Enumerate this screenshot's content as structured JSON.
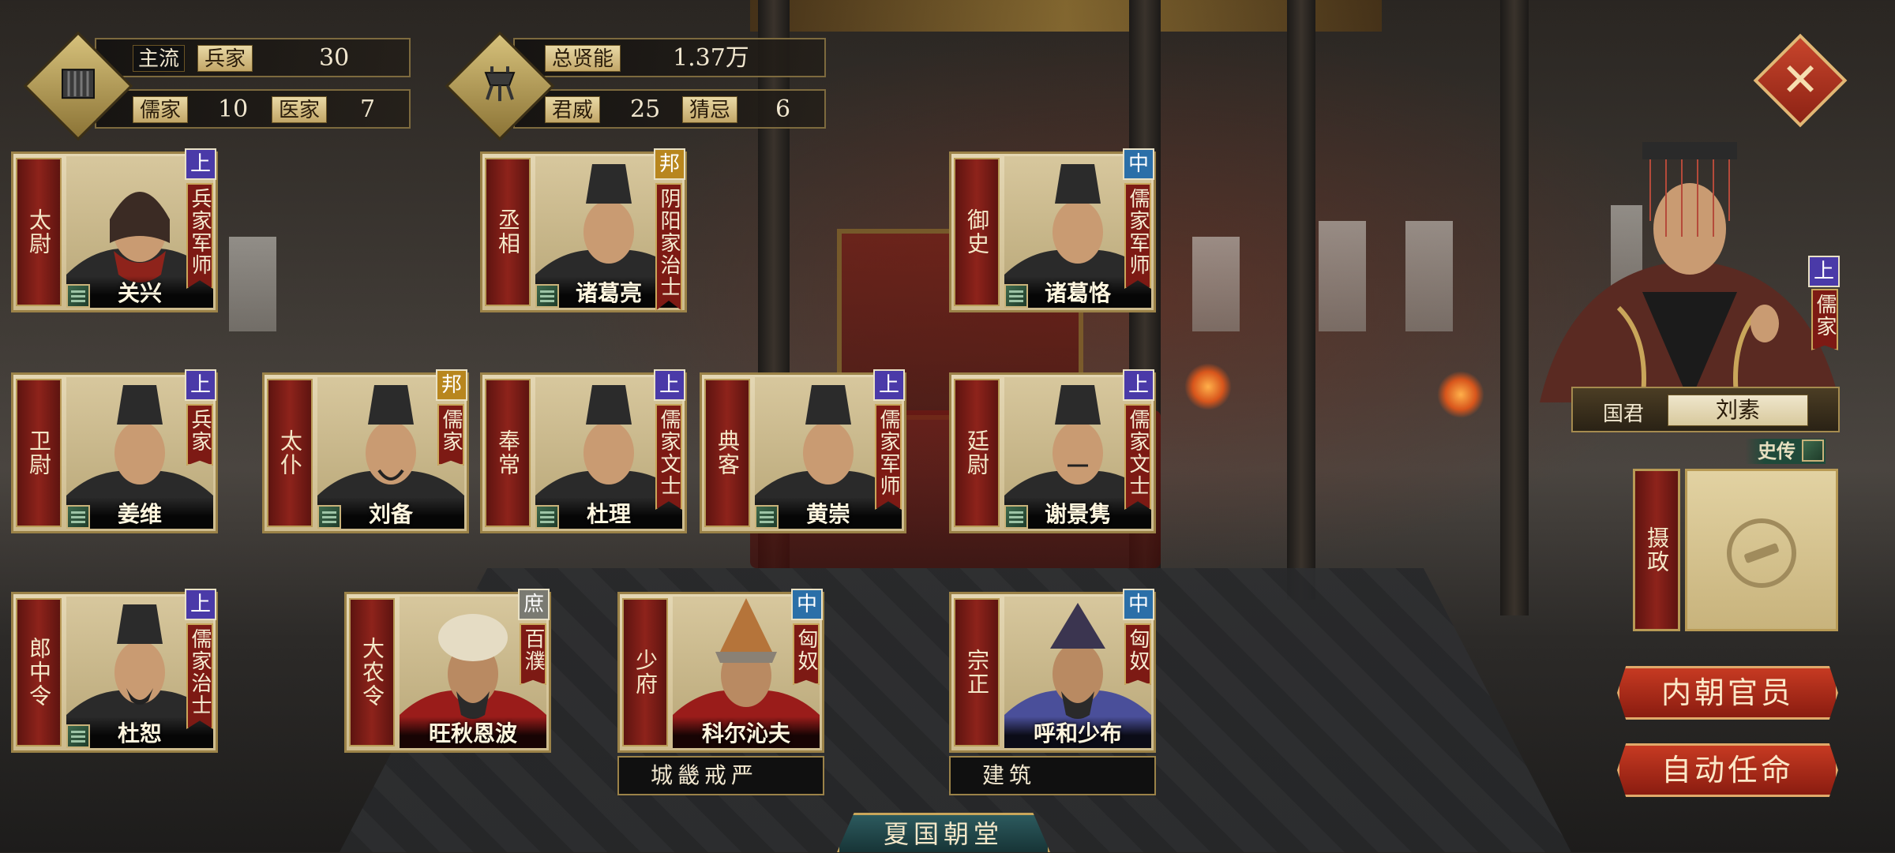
{
  "stats_left": {
    "row1": {
      "tag_label": "主流",
      "tag_value": "兵家",
      "value": "30"
    },
    "row2": [
      {
        "label": "儒家",
        "value": "10"
      },
      {
        "label": "医家",
        "value": "7"
      }
    ]
  },
  "stats_right": {
    "row1": {
      "label": "总贤能",
      "value": "1.37万"
    },
    "row2": [
      {
        "label": "君威",
        "value": "25"
      },
      {
        "label": "猜忌",
        "value": "6"
      }
    ]
  },
  "officials": [
    {
      "title": "太尉",
      "name": "关兴",
      "rank": "上",
      "school": "兵家军师"
    },
    {
      "title": "丞相",
      "name": "诸葛亮",
      "rank": "邦",
      "school": "阴阳家治士"
    },
    {
      "title": "御史",
      "name": "诸葛恪",
      "rank": "中",
      "school": "儒家军师"
    },
    {
      "title": "卫尉",
      "name": "姜维",
      "rank": "上",
      "school": "兵家"
    },
    {
      "title": "太仆",
      "name": "刘备",
      "rank": "邦",
      "school": "儒家"
    },
    {
      "title": "奉常",
      "name": "杜理",
      "rank": "上",
      "school": "儒家文士"
    },
    {
      "title": "典客",
      "name": "黄崇",
      "rank": "上",
      "school": "儒家军师"
    },
    {
      "title": "廷尉",
      "name": "谢景隽",
      "rank": "上",
      "school": "儒家文士"
    },
    {
      "title": "郎中令",
      "name": "杜恕",
      "rank": "上",
      "school": "儒家治士"
    },
    {
      "title": "大农令",
      "name": "旺秋恩波",
      "rank": "庶",
      "school": "百濮"
    },
    {
      "title": "少府",
      "name": "科尔沁夫",
      "rank": "中",
      "school": "匈奴"
    },
    {
      "title": "宗正",
      "name": "呼和少布",
      "rank": "中",
      "school": "匈奴"
    }
  ],
  "policies": {
    "shaofu": "城畿戒严",
    "zongzheng": "建筑"
  },
  "ruler": {
    "label": "国君",
    "name": "刘素",
    "rank": "上",
    "school": "儒家",
    "history_label": "史传"
  },
  "regent": {
    "title": "摄政"
  },
  "buttons": {
    "inner_court": "内朝官员",
    "auto_appoint": "自动任命",
    "close": "✕"
  },
  "court_tab": "夏国朝堂",
  "colors": {
    "rank_upper": "#4a3aa8",
    "rank_middle": "#2b6fa8",
    "rank_bang": "#b8861e",
    "rank_commoner": "#7a7a72",
    "accent_red": "#8e231b",
    "gold": "#c9a65a"
  }
}
